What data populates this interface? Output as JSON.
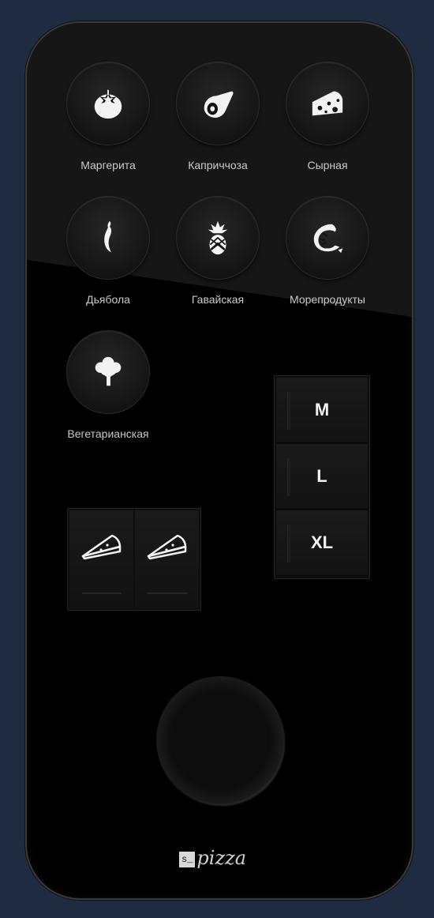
{
  "flavors": [
    {
      "label": "Маргерита",
      "icon": "tomato-icon"
    },
    {
      "label": "Каприччоза",
      "icon": "ham-icon"
    },
    {
      "label": "Сырная",
      "icon": "cheese-icon"
    },
    {
      "label": "Дьябола",
      "icon": "chili-pepper-icon"
    },
    {
      "label": "Гавайская",
      "icon": "pineapple-icon"
    },
    {
      "label": "Морепродукты",
      "icon": "shrimp-icon"
    },
    {
      "label": "Вегетарианская",
      "icon": "broccoli-icon"
    }
  ],
  "sizes": [
    "M",
    "L",
    "XL"
  ],
  "slices": [
    {
      "icon": "pizza-slice-icon"
    },
    {
      "icon": "pizza-slice-icon"
    }
  ],
  "logo": {
    "box": "s_",
    "word": "pizza"
  },
  "colors": {
    "background": "#1f2b40",
    "remote": "#000000",
    "button": "#141414",
    "label": "#c9c9c9"
  }
}
